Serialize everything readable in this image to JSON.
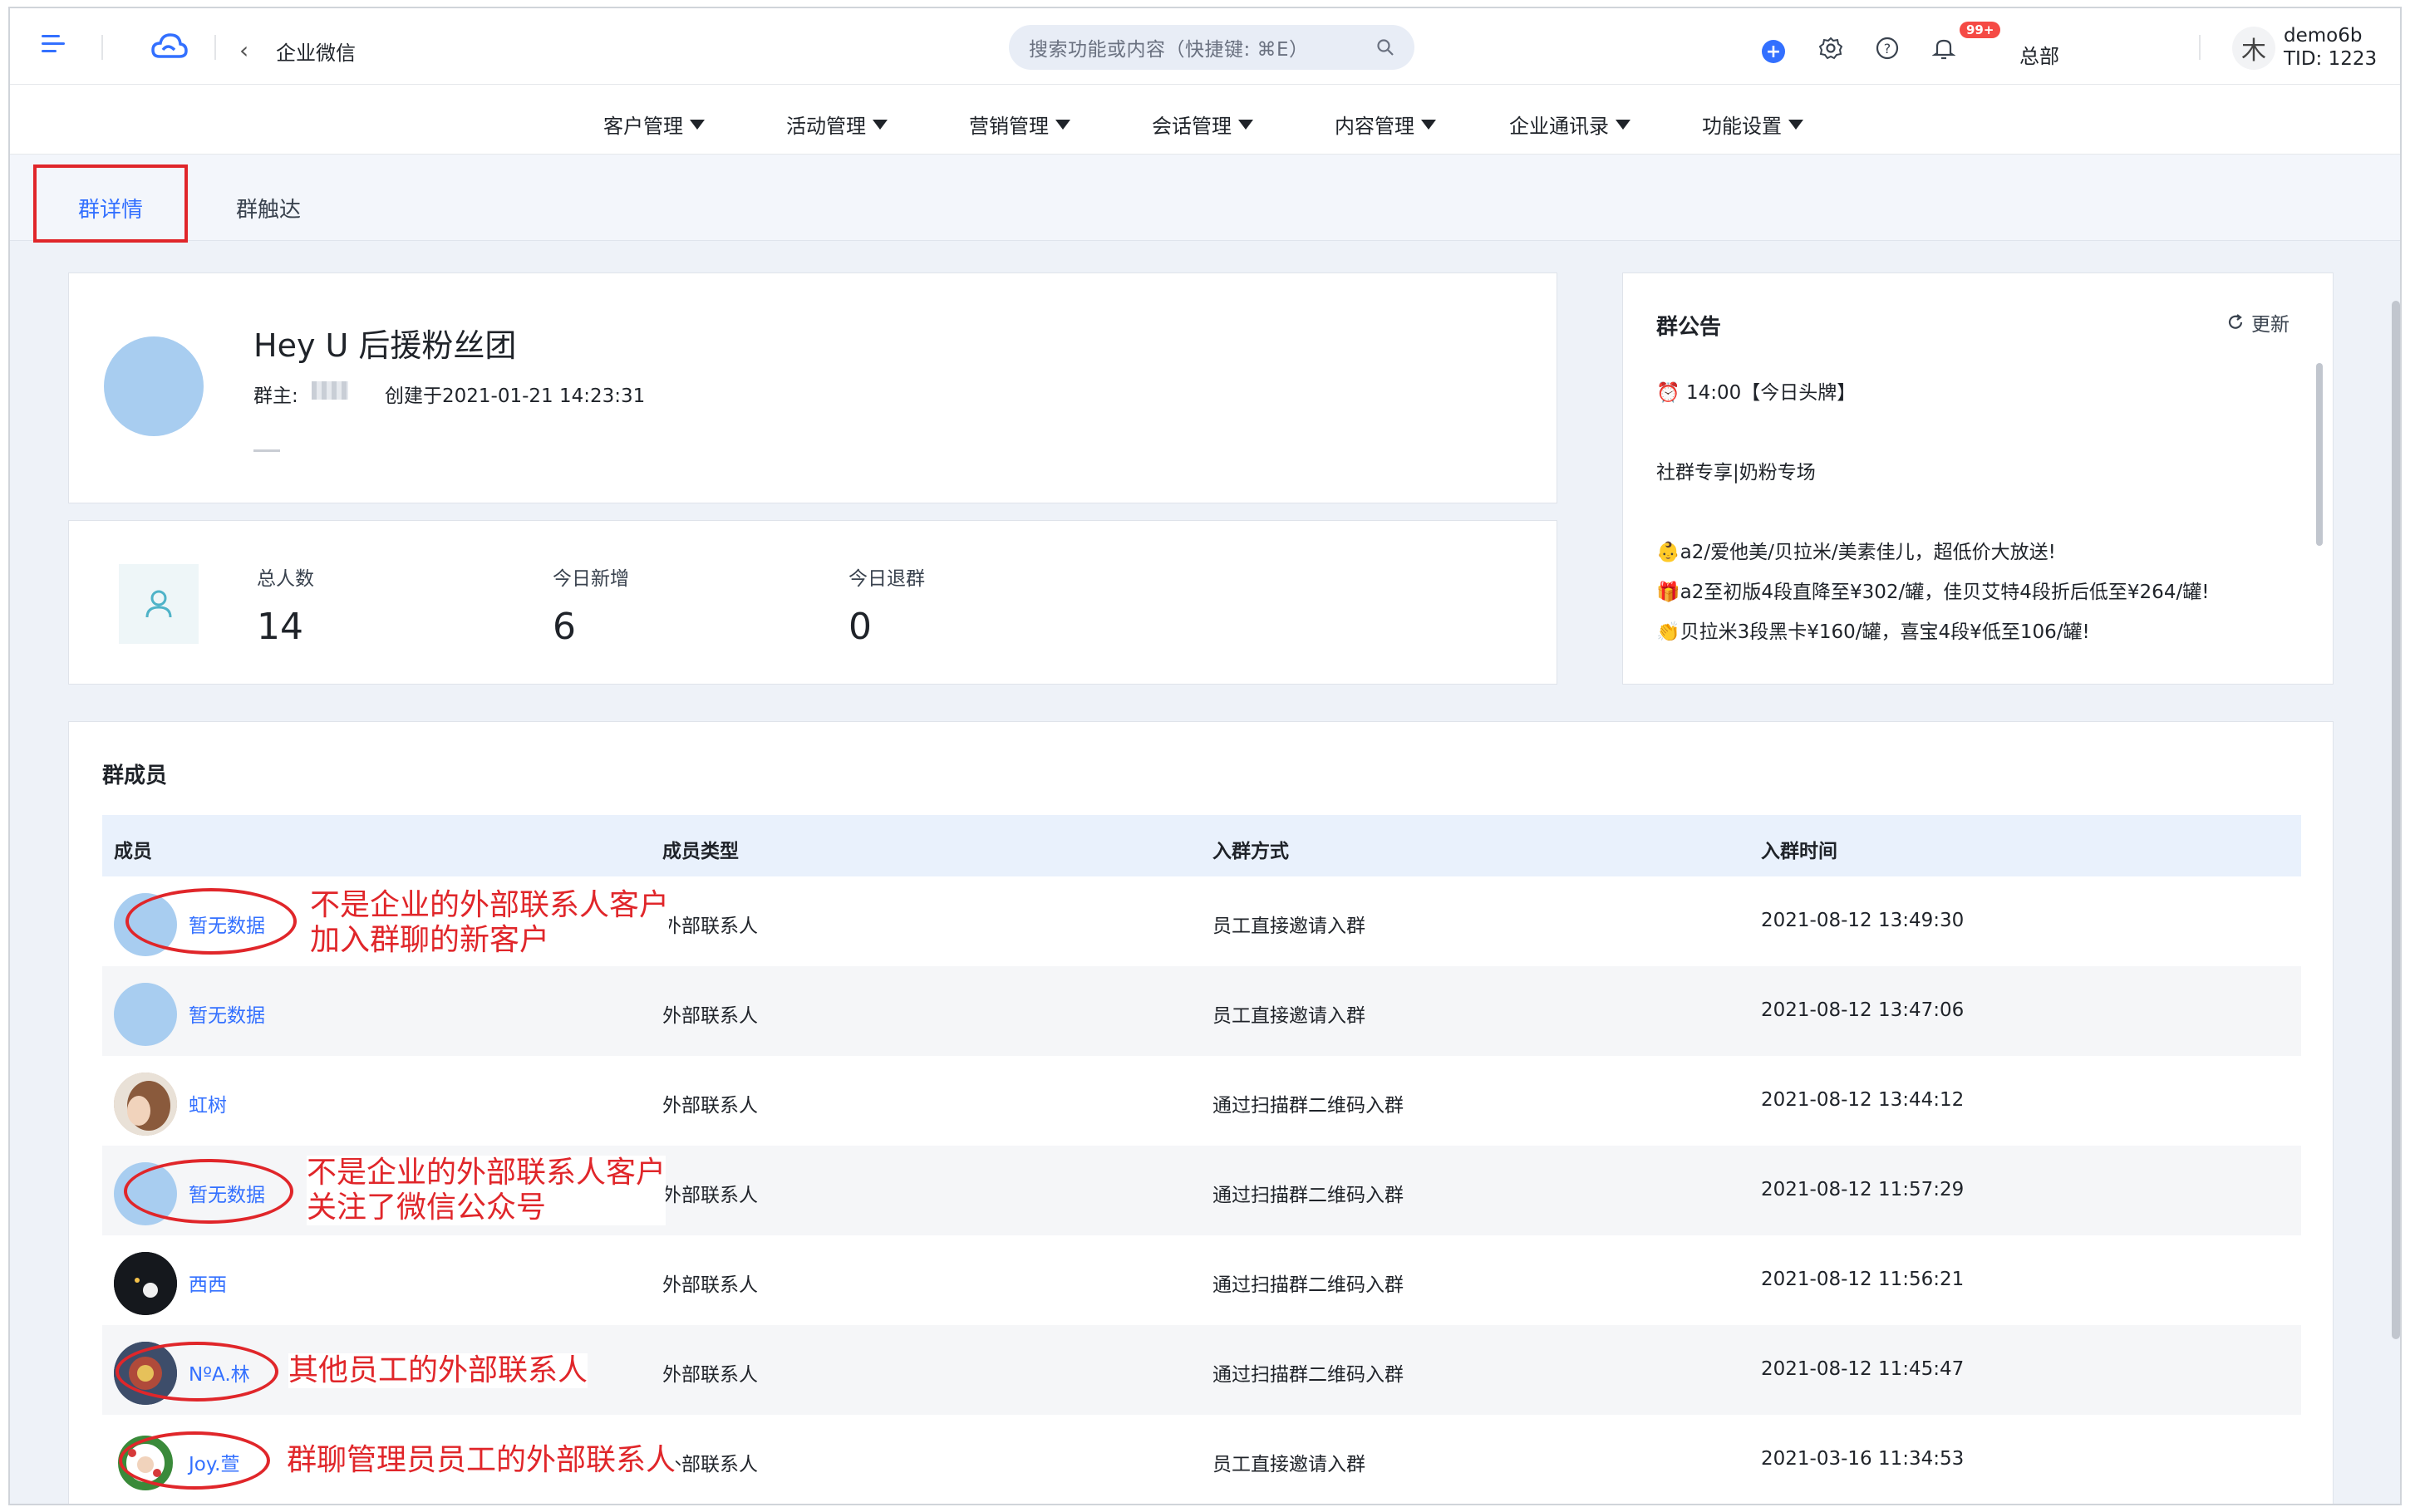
{
  "header": {
    "app_title": "企业微信",
    "search_placeholder": "搜索功能或内容（快捷键: ⌘E）",
    "badge": "99+",
    "org": "总部",
    "user_avatar_char": "木",
    "user_name": "demo6b",
    "user_tid": "TID: 1223"
  },
  "nav": [
    "客户管理",
    "活动管理",
    "营销管理",
    "会话管理",
    "内容管理",
    "企业通讯录",
    "功能设置"
  ],
  "tabs": [
    "群详情",
    "群触达"
  ],
  "group": {
    "name": "Hey U 后援粉丝团",
    "owner_label": "群主:",
    "created": "创建于2021-01-21 14:23:31"
  },
  "stats": [
    {
      "label": "总人数",
      "value": "14"
    },
    {
      "label": "今日新增",
      "value": "6"
    },
    {
      "label": "今日退群",
      "value": "0"
    }
  ],
  "notice": {
    "title": "群公告",
    "refresh_label": "更新",
    "lines": [
      "⏰ 14:00【今日头牌】",
      "社群专享|奶粉专场",
      "👶a2/爱他美/贝拉米/美素佳儿，超低价大放送!",
      "🎁a2至初版4段直降至¥302/罐，佳贝艾特4段折后低至¥264/罐!",
      "👏贝拉米3段黑卡¥160/罐，喜宝4段¥低至106/罐!"
    ]
  },
  "members": {
    "title": "群成员",
    "columns": [
      "成员",
      "成员类型",
      "入群方式",
      "入群时间"
    ],
    "rows": [
      {
        "name": "暂无数据",
        "type": "外部联系人",
        "join": "员工直接邀请入群",
        "time": "2021-08-12 13:49:30"
      },
      {
        "name": "暂无数据",
        "type": "外部联系人",
        "join": "员工直接邀请入群",
        "time": "2021-08-12 13:47:06"
      },
      {
        "name": "虹树",
        "type": "外部联系人",
        "join": "通过扫描群二维码入群",
        "time": "2021-08-12 13:44:12"
      },
      {
        "name": "暂无数据",
        "type": "外部联系人",
        "join": "通过扫描群二维码入群",
        "time": "2021-08-12 11:57:29"
      },
      {
        "name": "西西",
        "type": "外部联系人",
        "join": "通过扫描群二维码入群",
        "time": "2021-08-12 11:56:21"
      },
      {
        "name": "NºA.林",
        "type": "外部联系人",
        "join": "通过扫描群二维码入群",
        "time": "2021-08-12 11:45:47"
      },
      {
        "name": "Joy.萱",
        "type": "外部联系人",
        "join": "员工直接邀请入群",
        "time": "2021-03-16 11:34:53"
      }
    ]
  },
  "annotations": {
    "a1_line1": "不是企业的外部联系人客户",
    "a1_line2": "加入群聊的新客户",
    "a2_line1": "不是企业的外部联系人客户",
    "a2_line2": "关注了微信公众号",
    "a3": "其他员工的外部联系人",
    "a4": "群聊管理员员工的外部联系人"
  },
  "colors": {
    "accent": "#3370ff",
    "annotation_red": "#e0262a",
    "avatar_blue": "#a8cdf0"
  }
}
